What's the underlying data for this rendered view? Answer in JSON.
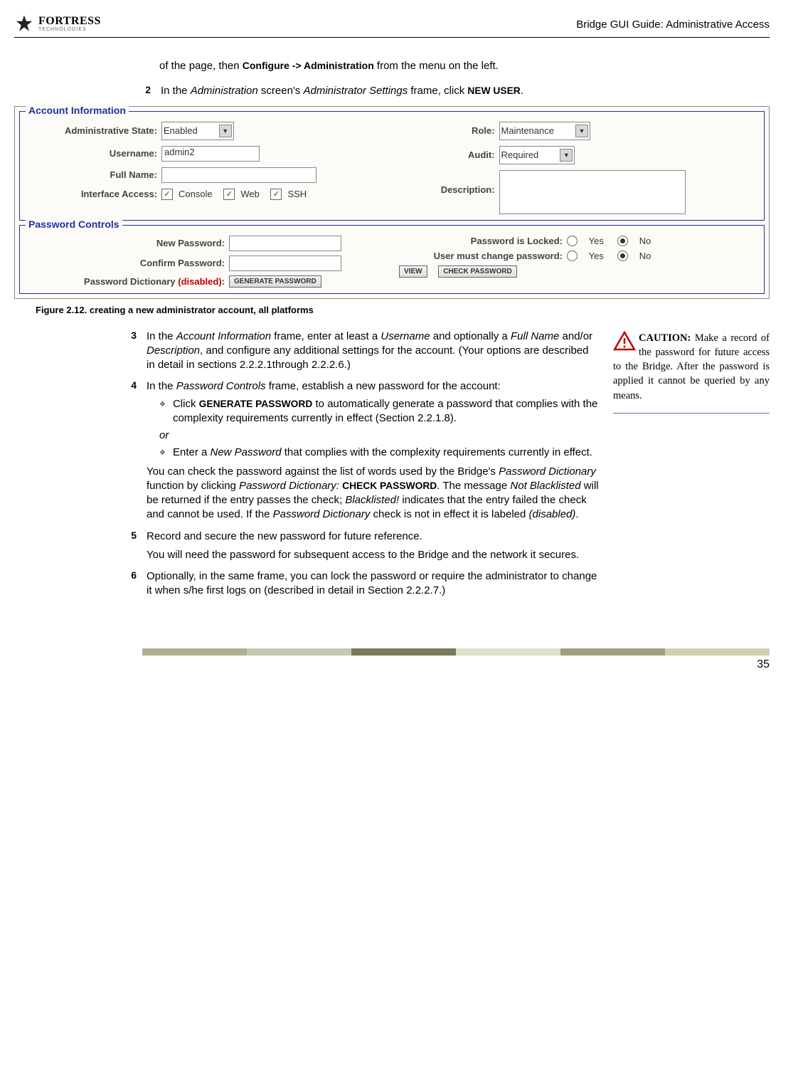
{
  "header": {
    "logo_name": "FORTRESS",
    "logo_sub": "TECHNOLOGIES",
    "title": "Bridge GUI Guide: Administrative Access"
  },
  "intro": {
    "p1_a": "of the page, then ",
    "p1_b": "Configure -> Administration",
    "p1_c": " from the menu on the left."
  },
  "step2": {
    "num": "2",
    "a": "In the ",
    "b": "Administration",
    "c": " screen's ",
    "d": "Administrator Settings",
    "e": " frame, click ",
    "f": "NEW USER",
    "g": "."
  },
  "screenshot": {
    "account_info_title": "Account Information",
    "admin_state_label": "Administrative State:",
    "admin_state_value": "Enabled",
    "username_label": "Username:",
    "username_value": "admin2",
    "fullname_label": "Full Name:",
    "interface_access_label": "Interface Access:",
    "chk_console": "Console",
    "chk_web": "Web",
    "chk_ssh": "SSH",
    "role_label": "Role:",
    "role_value": "Maintenance",
    "audit_label": "Audit:",
    "audit_value": "Required",
    "description_label": "Description:",
    "password_controls_title": "Password Controls",
    "new_password_label": "New Password:",
    "confirm_password_label": "Confirm Password:",
    "pw_dict_label_a": "Password Dictionary ",
    "pw_dict_label_b": "(disabled)",
    "pw_dict_label_c": ":",
    "gen_pw_btn": "GENERATE PASSWORD",
    "view_btn": "VIEW",
    "check_pw_btn": "CHECK PASSWORD",
    "pw_locked_label": "Password is Locked:",
    "must_change_label": "User must change password:",
    "yes": "Yes",
    "no": "No"
  },
  "figure_caption": "Figure 2.12. creating a new administrator account, all platforms",
  "step3": {
    "num": "3",
    "a": "In the ",
    "b": "Account Information",
    "c": " frame, enter at least a ",
    "d": "Username",
    "e": " and optionally a ",
    "f": "Full Name",
    "g": " and/or ",
    "h": "Description",
    "i": ", and configure any additional settings for the account. (Your options are described in detail in sections 2.2.2.1through 2.2.2.6.)"
  },
  "step4": {
    "num": "4",
    "a": "In the ",
    "b": "Password Controls",
    "c": " frame, establish a new password for the account:",
    "bullet1_a": "Click ",
    "bullet1_b": "GENERATE PASSWORD",
    "bullet1_c": " to automatically generate a password that complies with the complexity requirements currently in effect (Section 2.2.1.8).",
    "or": "or",
    "bullet2_a": "Enter a ",
    "bullet2_b": "New Password",
    "bullet2_c": " that complies with the complexity requirements currently in effect.",
    "p2_a": "You can check the password against the list of words used by the Bridge's ",
    "p2_b": "Password Dictionary",
    "p2_c": " function by clicking ",
    "p2_d": "Password Dictionary: ",
    "p2_e": "CHECK PASSWORD",
    "p2_f": ". The message ",
    "p2_g": "Not Blacklisted",
    "p2_h": " will be returned if the entry passes the check; ",
    "p2_i": "Blacklisted!",
    "p2_j": " indicates that the entry failed the check and cannot be used. If the ",
    "p2_k": "Password Dictionary",
    "p2_l": " check is not in effect it is labeled ",
    "p2_m": "(disabled)",
    "p2_n": "."
  },
  "step5": {
    "num": "5",
    "a": "Record and secure the new password for future reference.",
    "b": "You will need the password for subsequent access to the Bridge and the network it secures."
  },
  "step6": {
    "num": "6",
    "a": "Optionally, in the same frame, you can lock the password or require the administrator to change it when s/he first logs on (described in detail in Section 2.2.2.7.)"
  },
  "caution": {
    "label": "CAUTION:",
    "text": " Make a record of the password for future access to the Bridge. After the password is applied it cannot be queried by any means."
  },
  "footer": {
    "colors": [
      "#b0b090",
      "#c8c8b0",
      "#7a7a5a",
      "#e0e0c8",
      "#a0a080",
      "#d0d0b0"
    ],
    "page": "35"
  }
}
